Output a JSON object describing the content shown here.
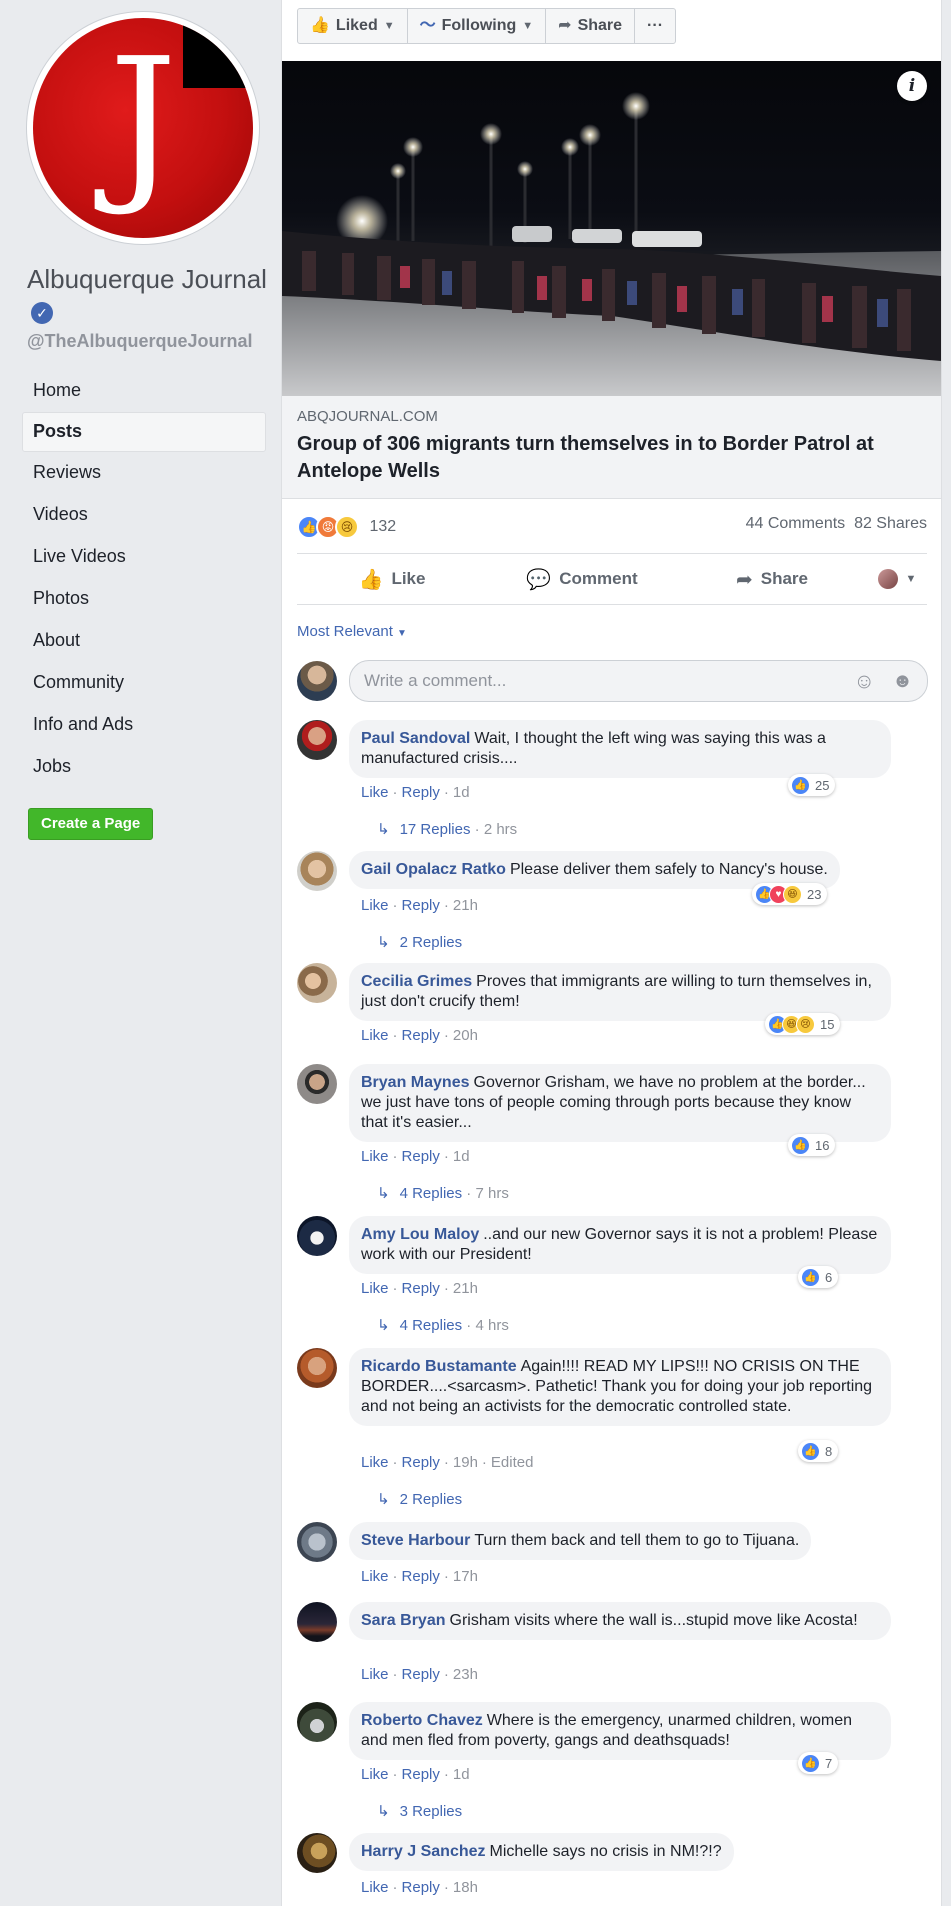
{
  "page": {
    "name": "Albuquerque Journal",
    "handle": "@TheAlbuquerqueJournal",
    "logo_letter": "J",
    "brand_red": "#c30f0f"
  },
  "nav": {
    "items": [
      "Home",
      "Posts",
      "Reviews",
      "Videos",
      "Live Videos",
      "Photos",
      "About",
      "Community",
      "Info and Ads",
      "Jobs"
    ],
    "active": "Posts",
    "create_page": "Create a Page"
  },
  "top_actions": {
    "liked": "Liked",
    "following": "Following",
    "share": "Share",
    "more": "···"
  },
  "post": {
    "link_domain": "ABQJOURNAL.COM",
    "link_title": "Group of 306 migrants turn themselves in to Border Patrol at Antelope Wells",
    "reaction_count": "132",
    "comments_count": "44 Comments",
    "shares_count": "82 Shares",
    "actions": {
      "like": "Like",
      "comment": "Comment",
      "share": "Share"
    },
    "sort": "Most Relevant",
    "composer_placeholder": "Write a comment..."
  },
  "comments": [
    {
      "author": "Paul Sandoval",
      "text": "Wait, I thought the left wing was saying this was a manufactured crisis....",
      "like": "Like",
      "reply": "Reply",
      "time": "1d",
      "edited": "",
      "reactions": [
        "like"
      ],
      "reaction_count": "25",
      "replies": "17 Replies",
      "replies_time": "2 hrs"
    },
    {
      "author": "Gail Opalacz Ratko",
      "text": "Please deliver them safely to Nancy's house.",
      "like": "Like",
      "reply": "Reply",
      "time": "21h",
      "edited": "",
      "reactions": [
        "like",
        "love",
        "haha"
      ],
      "reaction_count": "23",
      "replies": "2 Replies",
      "replies_time": ""
    },
    {
      "author": "Cecilia Grimes",
      "text": "Proves that immigrants are willing to turn themselves in, just don't crucify them!",
      "like": "Like",
      "reply": "Reply",
      "time": "20h",
      "edited": "",
      "reactions": [
        "like",
        "haha",
        "sad"
      ],
      "reaction_count": "15",
      "replies": "",
      "replies_time": ""
    },
    {
      "author": "Bryan Maynes",
      "text": "Governor Grisham, we have no problem at the border... we just have tons of people coming through ports because they know that it's easier...",
      "like": "Like",
      "reply": "Reply",
      "time": "1d",
      "edited": "",
      "reactions": [
        "like"
      ],
      "reaction_count": "16",
      "replies": "4 Replies",
      "replies_time": "7 hrs"
    },
    {
      "author": "Amy Lou Maloy",
      "text": "..and our new Governor says it is not a problem! Please work with our President!",
      "like": "Like",
      "reply": "Reply",
      "time": "21h",
      "edited": "",
      "reactions": [
        "like"
      ],
      "reaction_count": "6",
      "replies": "4 Replies",
      "replies_time": "4 hrs"
    },
    {
      "author": "Ricardo Bustamante",
      "text": "Again!!!! READ MY LIPS!!! NO CRISIS ON THE BORDER....<sarcasm>. Pathetic! Thank you for doing your job reporting and not being an activists for the democratic controlled state.",
      "like": "Like",
      "reply": "Reply",
      "time": "19h",
      "edited": "Edited",
      "reactions": [
        "like"
      ],
      "reaction_count": "8",
      "replies": "2 Replies",
      "replies_time": ""
    },
    {
      "author": "Steve Harbour",
      "text": "Turn them back and tell them to go to Tijuana.",
      "like": "Like",
      "reply": "Reply",
      "time": "17h",
      "edited": "",
      "reactions": [],
      "reaction_count": "",
      "replies": "",
      "replies_time": ""
    },
    {
      "author": "Sara Bryan",
      "text": "Grisham visits where the wall is...stupid move like Acosta!",
      "like": "Like",
      "reply": "Reply",
      "time": "23h",
      "edited": "",
      "reactions": [],
      "reaction_count": "",
      "replies": "",
      "replies_time": ""
    },
    {
      "author": "Roberto Chavez",
      "text": "Where is the emergency, unarmed children, women and men fled from poverty, gangs and deathsquads!",
      "like": "Like",
      "reply": "Reply",
      "time": "1d",
      "edited": "",
      "reactions": [
        "like"
      ],
      "reaction_count": "7",
      "replies": "3 Replies",
      "replies_time": ""
    },
    {
      "author": "Harry J Sanchez",
      "text": "Michelle says no crisis in NM!?!?",
      "like": "Like",
      "reply": "Reply",
      "time": "18h",
      "edited": "",
      "reactions": [],
      "reaction_count": "",
      "replies": "",
      "replies_time": ""
    }
  ]
}
